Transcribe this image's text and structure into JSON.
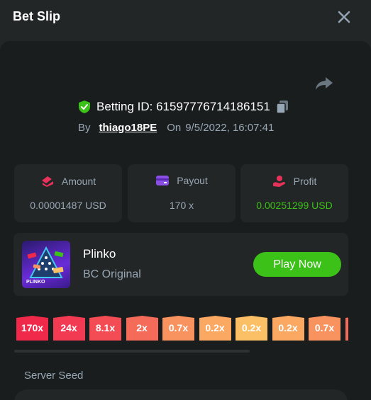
{
  "header": {
    "title": "Bet Slip"
  },
  "bet": {
    "betting_id_label": "Betting ID: 6159777671418615​1",
    "by_label": "By",
    "user": "thiago18PE",
    "on_label": "On",
    "date": "9/5/2022, 16:07:41"
  },
  "stats": {
    "amount_label": "Amount",
    "amount_value": "0.00001487 USD",
    "payout_label": "Payout",
    "payout_value": "170 x",
    "profit_label": "Profit",
    "profit_value": "0.00251299 USD"
  },
  "game": {
    "name": "Plinko",
    "subtitle": "BC Original",
    "play_label": "Play Now",
    "thumb_label": "PLINKO"
  },
  "multipliers": [
    {
      "label": "170x",
      "color": "#f0284a"
    },
    {
      "label": "24x",
      "color": "#f23a52"
    },
    {
      "label": "8.1x",
      "color": "#f34c55"
    },
    {
      "label": "2x",
      "color": "#f56b5a"
    },
    {
      "label": "0.7x",
      "color": "#f8935f"
    },
    {
      "label": "0.2x",
      "color": "#faa862"
    },
    {
      "label": "0.2x",
      "color": "#fbc065"
    },
    {
      "label": "0.2x",
      "color": "#faa862"
    },
    {
      "label": "0.7x",
      "color": "#f8935f"
    },
    {
      "label": "",
      "color": "#f56b5a"
    }
  ],
  "seed": {
    "label": "Server Seed"
  },
  "colors": {
    "accent_green": "#3bc117",
    "muted_text": "#98a7b5",
    "panel": "#1a1d1d",
    "card": "#232626"
  },
  "icons": {
    "close": "close-icon",
    "share": "share-icon",
    "verified": "shield-check-icon",
    "copy": "copy-icon",
    "amount": "wallet-icon",
    "payout": "card-icon",
    "profit": "profit-icon"
  }
}
